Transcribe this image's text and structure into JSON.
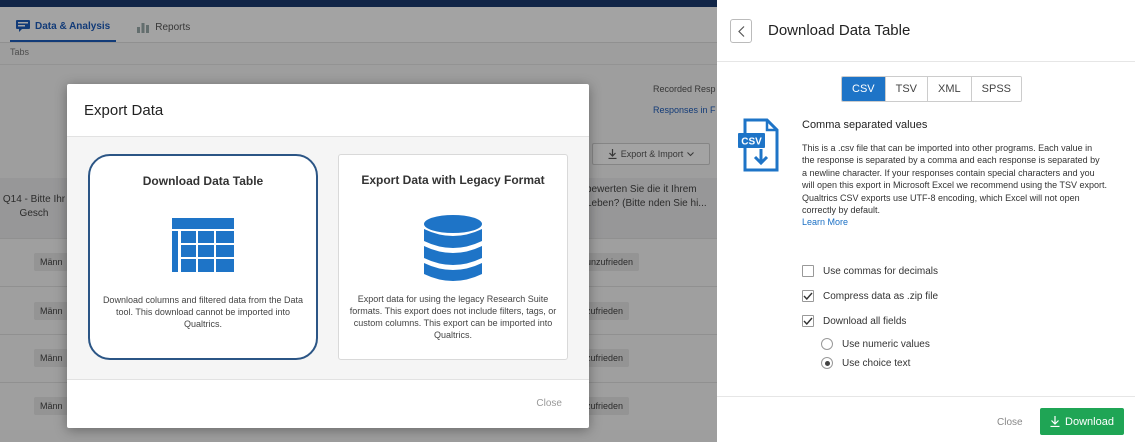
{
  "background": {
    "nav_tabs": [
      {
        "label": "Data & Analysis",
        "icon": "data-analysis-icon",
        "active": true
      },
      {
        "label": "Reports",
        "icon": "bar-chart-icon",
        "active": false
      }
    ],
    "subtab_label": "Tabs",
    "recorded_responses": "Recorded Resp",
    "responses_in": "Responses in F",
    "export_import": "Export & Import",
    "q14_text": "Q14 - Bitte Ihr Gesch",
    "q_right_text": "bewerten Sie die it Ihrem Leben? (Bitte nden Sie hi...",
    "rows": [
      {
        "left": "Männ",
        "right": "unzufrieden"
      },
      {
        "left": "Männ",
        "right": "zufrieden"
      },
      {
        "left": "Männ",
        "right": "zufrieden"
      },
      {
        "left": "Männ",
        "right": "zufrieden"
      }
    ]
  },
  "modal": {
    "title": "Export Data",
    "cards": [
      {
        "title": "Download Data Table",
        "icon": "table-grid-icon",
        "description": "Download columns and filtered data from the Data tool. This download cannot be imported into Qualtrics.",
        "selected": true
      },
      {
        "title": "Export Data with Legacy Format",
        "icon": "database-icon",
        "description": "Export data for using the legacy Research Suite formats. This export does not include filters, tags, or custom columns. This export can be imported into Qualtrics.",
        "selected": false
      }
    ],
    "close_label": "Close"
  },
  "panel": {
    "title": "Download Data Table",
    "back_icon": "chevron-left-icon",
    "formats": [
      {
        "label": "CSV",
        "active": true
      },
      {
        "label": "TSV",
        "active": false
      },
      {
        "label": "XML",
        "active": false
      },
      {
        "label": "SPSS",
        "active": false
      }
    ],
    "format_icon": "csv-file-download-icon",
    "format_icon_text": "CSV",
    "format_title": "Comma separated values",
    "format_description": "This is a .csv file that can be imported into other programs. Each value in the response is separated by a comma and each response is separated by a newline character. If your responses contain special characters and you will open this export in Microsoft Excel we recommend using the TSV export. Qualtrics CSV exports use UTF-8 encoding, which Excel will not open correctly by default.",
    "learn_more": "Learn More",
    "options": [
      {
        "label": "Use commas for decimals",
        "checked": false
      },
      {
        "label": "Compress data as .zip file",
        "checked": true
      },
      {
        "label": "Download all fields",
        "checked": true
      }
    ],
    "value_options": [
      {
        "label": "Use numeric values",
        "selected": false
      },
      {
        "label": "Use choice text",
        "selected": true
      }
    ],
    "close_label": "Close",
    "download_label": "Download"
  },
  "colors": {
    "accent_blue": "#1e74c7",
    "download_green": "#1fa555",
    "selected_card_border": "#2b5585"
  }
}
